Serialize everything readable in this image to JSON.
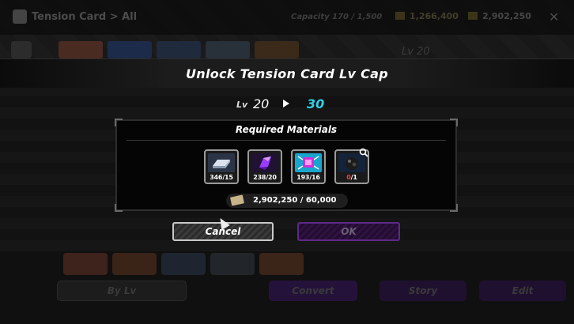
{
  "background": {
    "title": "Tension Card",
    "breadcrumb_sep": ">",
    "breadcrumb": "All",
    "capacity": "Capacity  170 / 1,500",
    "currency1": "1,266,400",
    "currency2": "2,902,250",
    "close": "✕",
    "level": "Lv 20",
    "sort_label": "By Lv",
    "convert_label": "Convert",
    "story_label": "Story",
    "edit_label": "Edit"
  },
  "modal": {
    "title": "Unlock Tension Card Lv Cap",
    "level_prefix": "Lv",
    "level_from": "20",
    "level_to": "30",
    "materials_title": "Required Materials",
    "materials": [
      {
        "have": "346",
        "need": "15",
        "icon": "silver-ingot-icon",
        "color": "#6d7d97"
      },
      {
        "have": "238",
        "need": "20",
        "icon": "purple-crystal-icon",
        "color": "#3e1a66"
      },
      {
        "have": "193",
        "need": "16",
        "icon": "magenta-chip-icon",
        "color": "#1aa4c8"
      },
      {
        "have": "0",
        "need": "1",
        "icon": "dark-orb-icon",
        "color": "#15233a"
      }
    ],
    "money_text": "2,902,250 / 60,000",
    "cancel_label": "Cancel",
    "ok_label": "OK"
  }
}
